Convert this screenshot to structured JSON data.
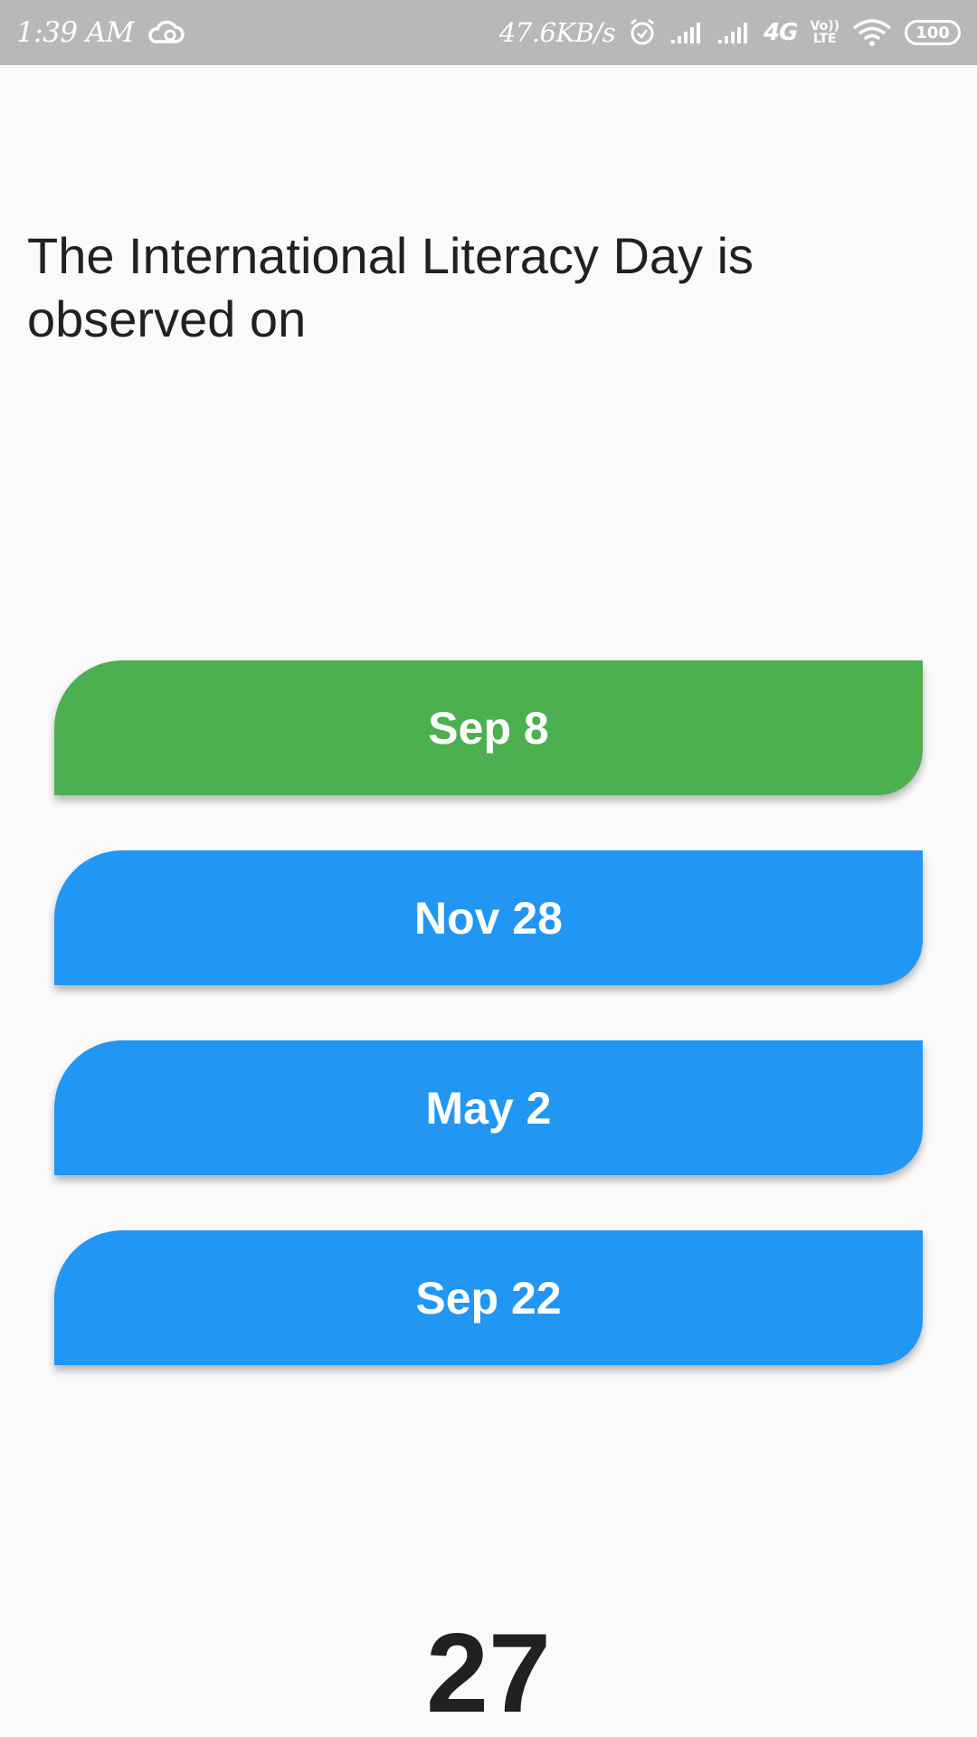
{
  "status_bar": {
    "time": "1:39 AM",
    "network_speed": "47.6KB/s",
    "network_type": "4G",
    "volte_top": "Vo))",
    "volte_bottom": "LTE",
    "battery": "100",
    "icons": [
      "cloud-icon",
      "alarm-icon",
      "signal-icon",
      "signal-icon",
      "wifi-icon",
      "battery-icon"
    ]
  },
  "quiz": {
    "question": "The International Literacy Day is observed on",
    "options": [
      {
        "label": "Sep 8",
        "color": "#4caf50",
        "state": "correct"
      },
      {
        "label": "Nov 28",
        "color": "#2196f3",
        "state": "default"
      },
      {
        "label": "May 2",
        "color": "#2196f3",
        "state": "default"
      },
      {
        "label": "Sep 22",
        "color": "#2196f3",
        "state": "default"
      }
    ],
    "timer": "27"
  }
}
